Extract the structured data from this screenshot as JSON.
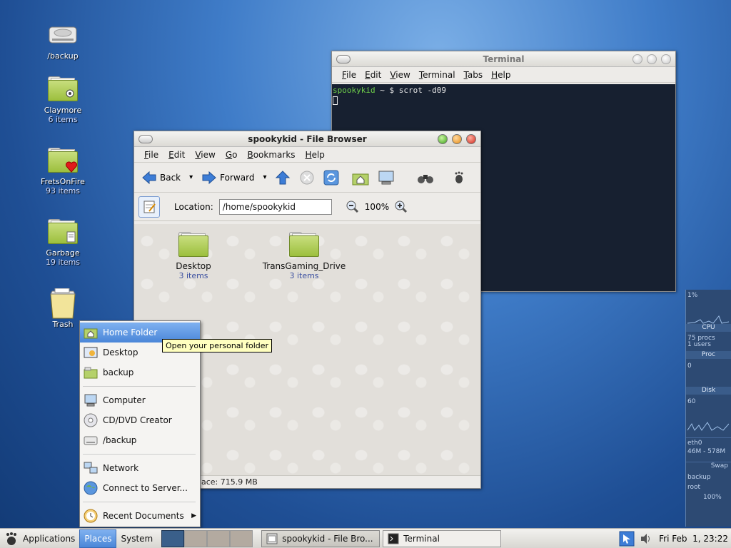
{
  "desktop_icons": [
    {
      "label": "/backup",
      "sub": ""
    },
    {
      "label": "Claymore",
      "sub": "6 items"
    },
    {
      "label": "FretsOnFire",
      "sub": "93 items"
    },
    {
      "label": "Garbage",
      "sub": "19 items"
    },
    {
      "label": "Trash",
      "sub": ""
    }
  ],
  "terminal": {
    "title": "Terminal",
    "menu": [
      "File",
      "Edit",
      "View",
      "Terminal",
      "Tabs",
      "Help"
    ],
    "prompt_user": "spookykid",
    "prompt_rest": " ~ $ scrot -d09"
  },
  "file_browser": {
    "title": "spookykid - File Browser",
    "menu": [
      "File",
      "Edit",
      "View",
      "Go",
      "Bookmarks",
      "Help"
    ],
    "back_label": "Back",
    "forward_label": "Forward",
    "location_label": "Location:",
    "location_value": "/home/spookykid",
    "zoom": "100%",
    "items": [
      {
        "name": "Desktop",
        "sub": "3 items"
      },
      {
        "name": "TransGaming_Drive",
        "sub": "3 items"
      }
    ],
    "status": "ace: 715.9 MB"
  },
  "places_menu": {
    "items": [
      "Home Folder",
      "Desktop",
      "backup",
      "Computer",
      "CD/DVD Creator",
      "/backup",
      "Network",
      "Connect to Server...",
      "Recent Documents"
    ],
    "tooltip": "Open your personal folder"
  },
  "panel": {
    "applications": "Applications",
    "places": "Places",
    "system": "System",
    "tasks": [
      "spookykid - File Bro...",
      "Terminal"
    ],
    "clock": "Fri Feb  1, 23:22"
  },
  "gkrellm": {
    "cpu_pct": "1%",
    "cpu_label": "CPU",
    "procs": "75 procs",
    "users": "1 users",
    "proc_label": "Proc",
    "disk_zero": "0",
    "disk_label": "Disk",
    "disk_val": "60",
    "net_label": "eth0",
    "mem": "46M - 578M",
    "swap_label": "Swap",
    "backup_label": "backup",
    "root_label": "root",
    "pct100": "100%"
  },
  "colors": {
    "selection": "#4a86d8",
    "terminal_bg": "#172030",
    "prompt_green": "#6fd04a",
    "folder_green": "#9cbf3d"
  }
}
